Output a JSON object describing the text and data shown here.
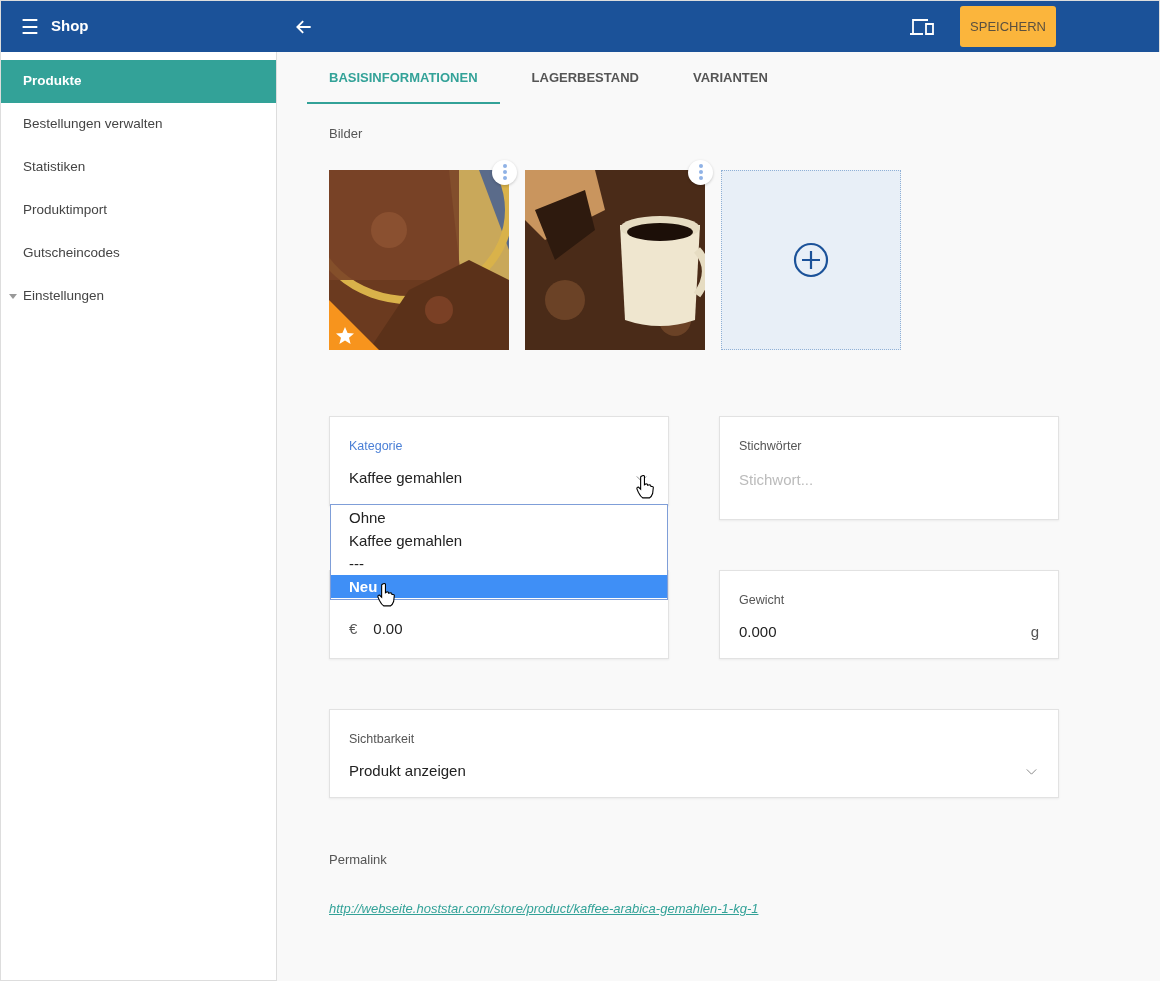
{
  "header": {
    "menu": "☰",
    "title": "Shop",
    "save_button": "SPEICHERN"
  },
  "sidebar": {
    "items": [
      {
        "label": "Produkte",
        "selected": true,
        "kind": "link"
      },
      {
        "label": "Bestellungen verwalten",
        "selected": false,
        "kind": "link"
      },
      {
        "label": "Statistiken",
        "selected": false,
        "kind": "link"
      },
      {
        "label": "Produktimport",
        "selected": false,
        "kind": "link"
      },
      {
        "label": "Gutscheincodes",
        "selected": false,
        "kind": "link"
      },
      {
        "label": "Einstellungen",
        "selected": false,
        "kind": "group"
      }
    ]
  },
  "tabs": [
    {
      "label": "BASISINFORMATIONEN",
      "selected": true
    },
    {
      "label": "LAGERBESTAND",
      "selected": false
    },
    {
      "label": "VARIANTEN",
      "selected": false
    }
  ],
  "images": {
    "label": "Bilder",
    "items": [
      {
        "kind": "grounds",
        "featured": true
      },
      {
        "kind": "mug",
        "featured": false
      }
    ]
  },
  "category": {
    "label": "Kategorie",
    "value": "Kaffee gemahlen",
    "open": true,
    "options": [
      {
        "label": "Ohne",
        "highlighted": false
      },
      {
        "label": "Kaffee gemahlen",
        "highlighted": false
      },
      {
        "label": "---",
        "highlighted": false
      },
      {
        "label": "Neu",
        "highlighted": true
      }
    ]
  },
  "keywords": {
    "label": "Stichwörter",
    "placeholder": "Stichwort..."
  },
  "price": {
    "currency": "€",
    "value": "0.00"
  },
  "weight": {
    "label": "Gewicht",
    "value": "0.000",
    "unit": "g"
  },
  "visibility": {
    "label": "Sichtbarkeit",
    "value": "Produkt anzeigen"
  },
  "permalink": {
    "label": "Permalink",
    "url": "http://webseite.hoststar.com/store/product/kaffee-arabica-gemahlen-1-kg-1"
  }
}
